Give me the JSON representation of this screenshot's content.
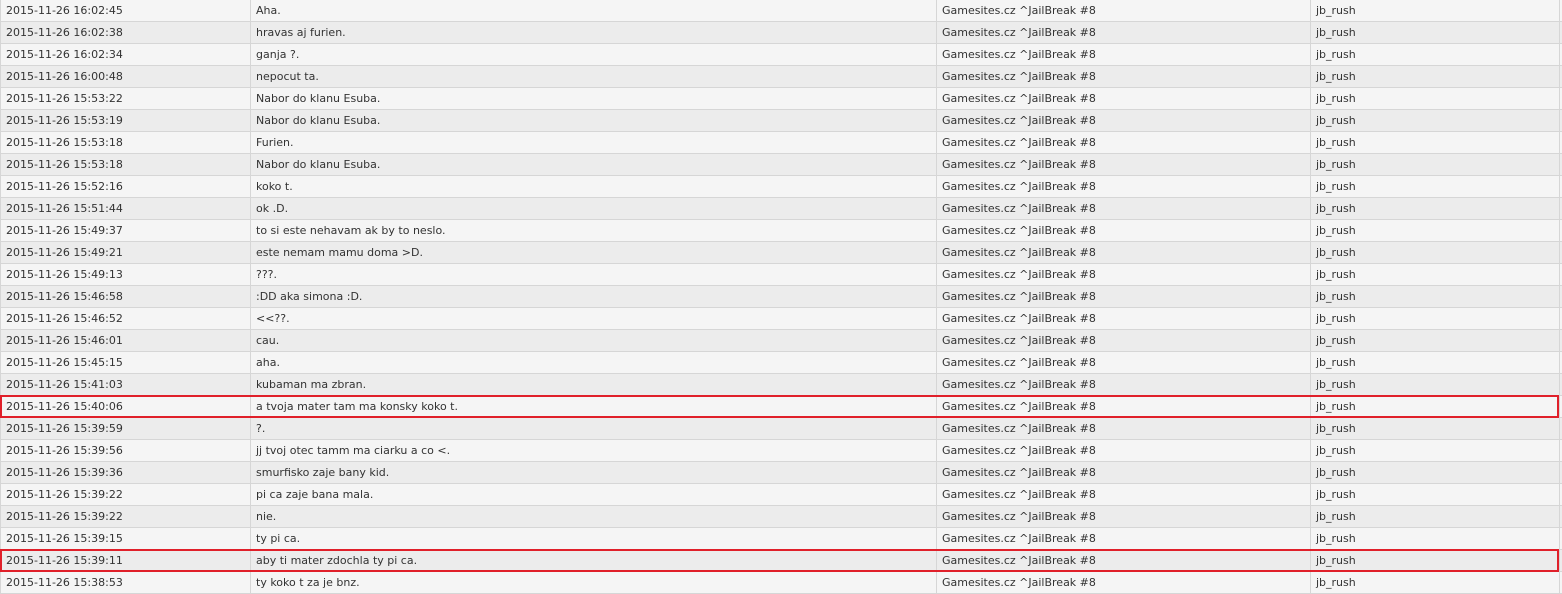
{
  "chat_log": {
    "rows": [
      {
        "time": "2015-11-26 16:02:45",
        "message": "Aha.",
        "server": "Gamesites.cz ^JailBreak #8",
        "map": "jb_rush",
        "highlighted": false
      },
      {
        "time": "2015-11-26 16:02:38",
        "message": "hravas aj furien.",
        "server": "Gamesites.cz ^JailBreak #8",
        "map": "jb_rush",
        "highlighted": false
      },
      {
        "time": "2015-11-26 16:02:34",
        "message": "ganja ?.",
        "server": "Gamesites.cz ^JailBreak #8",
        "map": "jb_rush",
        "highlighted": false
      },
      {
        "time": "2015-11-26 16:00:48",
        "message": "nepocut ta.",
        "server": "Gamesites.cz ^JailBreak #8",
        "map": "jb_rush",
        "highlighted": false
      },
      {
        "time": "2015-11-26 15:53:22",
        "message": "Nabor do klanu Esuba.",
        "server": "Gamesites.cz ^JailBreak #8",
        "map": "jb_rush",
        "highlighted": false
      },
      {
        "time": "2015-11-26 15:53:19",
        "message": "Nabor do klanu Esuba.",
        "server": "Gamesites.cz ^JailBreak #8",
        "map": "jb_rush",
        "highlighted": false
      },
      {
        "time": "2015-11-26 15:53:18",
        "message": "Furien.",
        "server": "Gamesites.cz ^JailBreak #8",
        "map": "jb_rush",
        "highlighted": false
      },
      {
        "time": "2015-11-26 15:53:18",
        "message": "Nabor do klanu Esuba.",
        "server": "Gamesites.cz ^JailBreak #8",
        "map": "jb_rush",
        "highlighted": false
      },
      {
        "time": "2015-11-26 15:52:16",
        "message": "koko t.",
        "server": "Gamesites.cz ^JailBreak #8",
        "map": "jb_rush",
        "highlighted": false
      },
      {
        "time": "2015-11-26 15:51:44",
        "message": "ok .D.",
        "server": "Gamesites.cz ^JailBreak #8",
        "map": "jb_rush",
        "highlighted": false
      },
      {
        "time": "2015-11-26 15:49:37",
        "message": "to si este nehavam ak by to neslo.",
        "server": "Gamesites.cz ^JailBreak #8",
        "map": "jb_rush",
        "highlighted": false
      },
      {
        "time": "2015-11-26 15:49:21",
        "message": "este nemam mamu doma >D.",
        "server": "Gamesites.cz ^JailBreak #8",
        "map": "jb_rush",
        "highlighted": false
      },
      {
        "time": "2015-11-26 15:49:13",
        "message": "???.",
        "server": "Gamesites.cz ^JailBreak #8",
        "map": "jb_rush",
        "highlighted": false
      },
      {
        "time": "2015-11-26 15:46:58",
        "message": ":DD aka simona :D.",
        "server": "Gamesites.cz ^JailBreak #8",
        "map": "jb_rush",
        "highlighted": false
      },
      {
        "time": "2015-11-26 15:46:52",
        "message": "<<??.",
        "server": "Gamesites.cz ^JailBreak #8",
        "map": "jb_rush",
        "highlighted": false
      },
      {
        "time": "2015-11-26 15:46:01",
        "message": "cau.",
        "server": "Gamesites.cz ^JailBreak #8",
        "map": "jb_rush",
        "highlighted": false
      },
      {
        "time": "2015-11-26 15:45:15",
        "message": "aha.",
        "server": "Gamesites.cz ^JailBreak #8",
        "map": "jb_rush",
        "highlighted": false
      },
      {
        "time": "2015-11-26 15:41:03",
        "message": "kubaman ma zbran.",
        "server": "Gamesites.cz ^JailBreak #8",
        "map": "jb_rush",
        "highlighted": false
      },
      {
        "time": "2015-11-26 15:40:06",
        "message": "a tvoja mater tam ma konsky koko t.",
        "server": "Gamesites.cz ^JailBreak #8",
        "map": "jb_rush",
        "highlighted": true
      },
      {
        "time": "2015-11-26 15:39:59",
        "message": "?.",
        "server": "Gamesites.cz ^JailBreak #8",
        "map": "jb_rush",
        "highlighted": false
      },
      {
        "time": "2015-11-26 15:39:56",
        "message": "jj tvoj otec tamm ma ciarku a co <.",
        "server": "Gamesites.cz ^JailBreak #8",
        "map": "jb_rush",
        "highlighted": false
      },
      {
        "time": "2015-11-26 15:39:36",
        "message": "smurfisko zaje bany kid.",
        "server": "Gamesites.cz ^JailBreak #8",
        "map": "jb_rush",
        "highlighted": false
      },
      {
        "time": "2015-11-26 15:39:22",
        "message": "pi ca zaje bana mala.",
        "server": "Gamesites.cz ^JailBreak #8",
        "map": "jb_rush",
        "highlighted": false
      },
      {
        "time": "2015-11-26 15:39:22",
        "message": "nie.",
        "server": "Gamesites.cz ^JailBreak #8",
        "map": "jb_rush",
        "highlighted": false
      },
      {
        "time": "2015-11-26 15:39:15",
        "message": "ty pi ca.",
        "server": "Gamesites.cz ^JailBreak #8",
        "map": "jb_rush",
        "highlighted": false
      },
      {
        "time": "2015-11-26 15:39:11",
        "message": "aby ti mater zdochla ty pi ca.",
        "server": "Gamesites.cz ^JailBreak #8",
        "map": "jb_rush",
        "highlighted": true
      },
      {
        "time": "2015-11-26 15:38:53",
        "message": "ty koko t za je bnz.",
        "server": "Gamesites.cz ^JailBreak #8",
        "map": "jb_rush",
        "highlighted": false
      }
    ]
  },
  "colors": {
    "highlight_border": "#e0202a",
    "row_odd": "#f5f5f5",
    "row_even": "#ececec",
    "grid_line": "#d6d6d6",
    "text": "#333333"
  }
}
